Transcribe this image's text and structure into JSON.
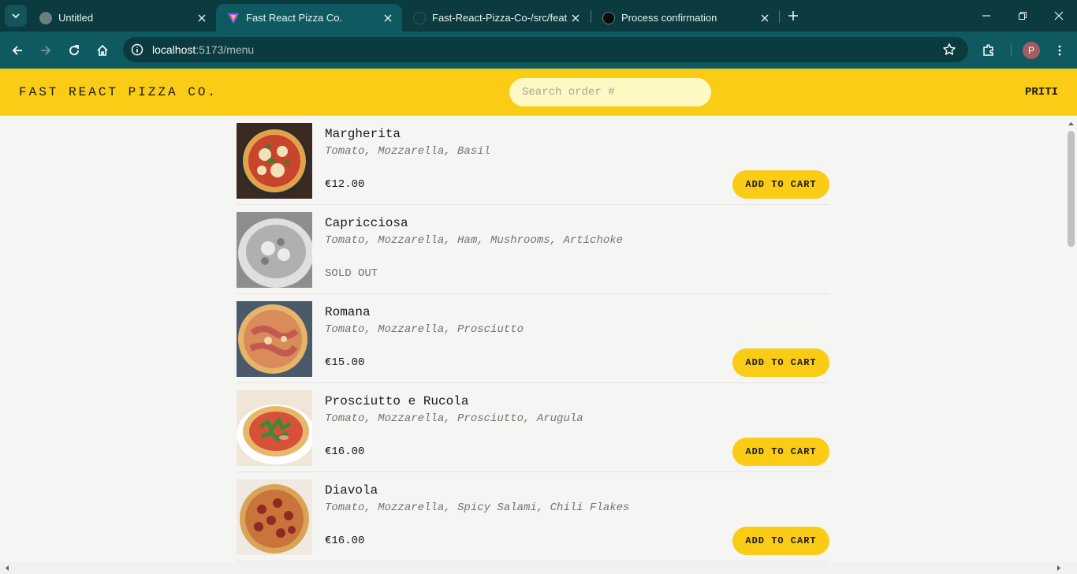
{
  "browser": {
    "tabs": [
      {
        "title": "Untitled",
        "icon": "globe-icon",
        "active": false
      },
      {
        "title": "Fast React Pizza Co.",
        "icon": "vite-icon",
        "active": true
      },
      {
        "title": "Fast-React-Pizza-Co-/src/featur",
        "icon": "github-icon",
        "active": false
      },
      {
        "title": "Process confirmation",
        "icon": "openai-icon",
        "active": false
      }
    ],
    "url_host": "localhost",
    "url_path": ":5173/menu",
    "profile_initial": "P"
  },
  "header": {
    "logo": "FAST REACT PIZZA CO.",
    "search_placeholder": "Search order #",
    "username": "PRITI"
  },
  "menu": {
    "add_label": "ADD TO CART",
    "sold_out_label": "SOLD OUT",
    "items": [
      {
        "name": "Margherita",
        "ingredients": "Tomato, Mozzarella, Basil",
        "price": "€12.00",
        "sold_out": false
      },
      {
        "name": "Capricciosa",
        "ingredients": "Tomato, Mozzarella, Ham, Mushrooms, Artichoke",
        "price": "",
        "sold_out": true
      },
      {
        "name": "Romana",
        "ingredients": "Tomato, Mozzarella, Prosciutto",
        "price": "€15.00",
        "sold_out": false
      },
      {
        "name": "Prosciutto e Rucola",
        "ingredients": "Tomato, Mozzarella, Prosciutto, Arugula",
        "price": "€16.00",
        "sold_out": false
      },
      {
        "name": "Diavola",
        "ingredients": "Tomato, Mozzarella, Spicy Salami, Chili Flakes",
        "price": "€16.00",
        "sold_out": false
      }
    ]
  },
  "colors": {
    "brand_yellow": "#facc15",
    "chrome_teal": "#0f5a60"
  }
}
